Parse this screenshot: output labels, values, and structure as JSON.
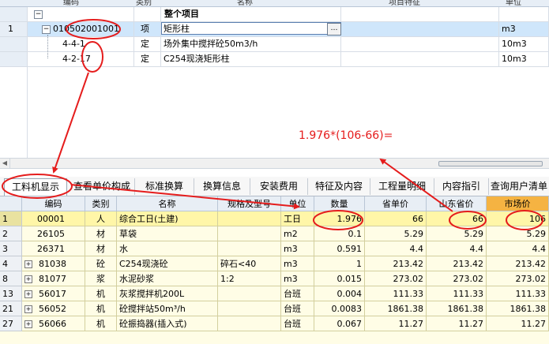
{
  "upper": {
    "header_fragments": [
      "编码",
      "类别",
      "名称",
      "项目特征",
      "单位"
    ],
    "rows": [
      {
        "num": "",
        "code": "",
        "type": "",
        "name": "整个项目",
        "unit": ""
      },
      {
        "num": "1",
        "code": "010502001001",
        "type": "项",
        "name": "矩形柱",
        "unit": "m3"
      },
      {
        "num": "",
        "code": "4-4-1",
        "type": "定",
        "name": "场外集中搅拌砼50m3/h",
        "unit": "10m3"
      },
      {
        "num": "",
        "code": "4-2-17",
        "type": "定",
        "name": "C254现浇矩形柱",
        "unit": "10m3"
      }
    ],
    "ellipsis": "…"
  },
  "tabs": [
    "工料机显示",
    "查看单价构成",
    "标准换算",
    "换算信息",
    "安装费用",
    "特征及内容",
    "工程量明细",
    "内容指引",
    "查询用户清单"
  ],
  "annotation": {
    "formula": "1.976*(106-66)="
  },
  "lower": {
    "headers": [
      "",
      "编码",
      "类别",
      "名称",
      "规格及型号",
      "单位",
      "数量",
      "省单价",
      "山东省价",
      "市场价"
    ],
    "rows": [
      {
        "num": "1",
        "expand": false,
        "code": "00001",
        "type": "人",
        "name": "综合工日(土建)",
        "spec": "",
        "unit": "工日",
        "qty": "1.976",
        "prov": "66",
        "sd": "66",
        "market": "106"
      },
      {
        "num": "2",
        "expand": false,
        "code": "26105",
        "type": "材",
        "name": "草袋",
        "spec": "",
        "unit": "m2",
        "qty": "0.1",
        "prov": "5.29",
        "sd": "5.29",
        "market": "5.29"
      },
      {
        "num": "3",
        "expand": false,
        "code": "26371",
        "type": "材",
        "name": "水",
        "spec": "",
        "unit": "m3",
        "qty": "0.591",
        "prov": "4.4",
        "sd": "4.4",
        "market": "4.4"
      },
      {
        "num": "4",
        "expand": true,
        "code": "81038",
        "type": "砼",
        "name": "C254现浇砼",
        "spec": "碎石<40",
        "unit": "m3",
        "qty": "1",
        "prov": "213.42",
        "sd": "213.42",
        "market": "213.42"
      },
      {
        "num": "8",
        "expand": true,
        "code": "81077",
        "type": "浆",
        "name": "水泥砂浆",
        "spec": "1:2",
        "unit": "m3",
        "qty": "0.015",
        "prov": "273.02",
        "sd": "273.02",
        "market": "273.02"
      },
      {
        "num": "13",
        "expand": true,
        "code": "56017",
        "type": "机",
        "name": "灰浆搅拌机200L",
        "spec": "",
        "unit": "台班",
        "qty": "0.004",
        "prov": "111.33",
        "sd": "111.33",
        "market": "111.33"
      },
      {
        "num": "21",
        "expand": true,
        "code": "56052",
        "type": "机",
        "name": "砼搅拌站50m³/h",
        "spec": "",
        "unit": "台班",
        "qty": "0.0083",
        "prov": "1861.38",
        "sd": "1861.38",
        "market": "1861.38"
      },
      {
        "num": "27",
        "expand": true,
        "code": "56066",
        "type": "机",
        "name": "砼振捣器(插入式)",
        "spec": "",
        "unit": "台班",
        "qty": "0.067",
        "prov": "11.27",
        "sd": "11.27",
        "market": "11.27"
      }
    ]
  },
  "colors": {
    "annotation_red": "#e51c1c",
    "market_header": "#f5b342",
    "selected_row": "#cfe6fb",
    "grid_bg": "#fffde6"
  }
}
